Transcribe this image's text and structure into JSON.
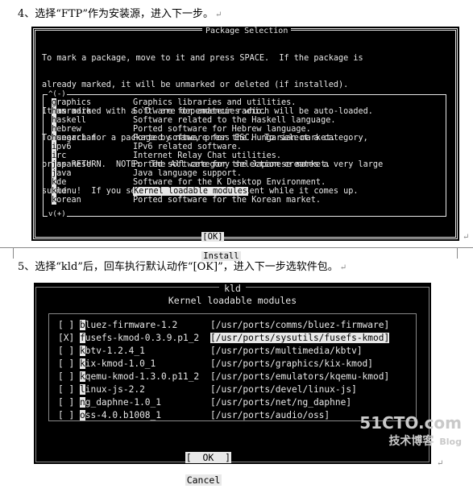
{
  "step4": {
    "caption": "4、选择“FTP”作为安装源，进入下一步。",
    "return_mark": "↵"
  },
  "screen1": {
    "title": "Package Selection",
    "intro_lines": [
      "To mark a package, move to it and press SPACE.  If the package is",
      "already marked, it will be unmarked or deleted (if installed).",
      "Items marked with a `D' are dependencies which will be auto-loaded.",
      "To search for a package by name, press ESC.  To select a category,",
      "press RETURN.  NOTE:  The All category selection creates a very large",
      "submenu!  If you select it, please be patient while it comes up."
    ],
    "scroll_up": "^(-)",
    "scroll_down": "v(+)",
    "categories": [
      {
        "name": "graphics",
        "desc": "Graphics libraries and utilities."
      },
      {
        "name": "hamradio",
        "desc": "Software for amateur radio."
      },
      {
        "name": "haskell",
        "desc": "Software related to the Haskell language."
      },
      {
        "name": "hebrew",
        "desc": "Ported software for Hebrew language."
      },
      {
        "name": "hungarian",
        "desc": "Ported software for the Hungarian market."
      },
      {
        "name": "ipv6",
        "desc": "IPv6 related software."
      },
      {
        "name": "irc",
        "desc": "Internet Relay Chat utilities."
      },
      {
        "name": "japanese",
        "desc": "Ported software for the Japanese market."
      },
      {
        "name": "java",
        "desc": "Java language support."
      },
      {
        "name": "kde",
        "desc": "Software for the K Desktop Environment."
      },
      {
        "name": "kld",
        "desc": "Kernel loadable modules"
      },
      {
        "name": "korean",
        "desc": "Ported software for the Korean market."
      }
    ],
    "selected_index": 10,
    "ok_label": "[OK]",
    "install_label": "Install"
  },
  "step5": {
    "caption": "5、选择“kld”后，回车执行默认动作“[OK]”，进入下一步选软件包。",
    "return_mark": "↵"
  },
  "screen2": {
    "title": "kld",
    "subtitle": "Kernel loadable modules",
    "packages": [
      {
        "mark": "[ ]",
        "name": "bluez-firmware-1.2",
        "path": "[/usr/ports/comms/bluez-firmware]"
      },
      {
        "mark": "[X]",
        "name": "fusefs-kmod-0.3.9.p1_2",
        "path": "[/usr/ports/sysutils/fusefs-kmod]"
      },
      {
        "mark": "[ ]",
        "name": "kbtv-1.2.4_1",
        "path": "[/usr/ports/multimedia/kbtv]"
      },
      {
        "mark": "[ ]",
        "name": "kix-kmod-1.0_1",
        "path": "[/usr/ports/graphics/kix-kmod]"
      },
      {
        "mark": "[ ]",
        "name": "kqemu-kmod-1.3.0.p11_2",
        "path": "[/usr/ports/emulators/kqemu-kmod]"
      },
      {
        "mark": "[ ]",
        "name": "linux-js-2.2",
        "path": "[/usr/ports/devel/linux-js]"
      },
      {
        "mark": "[ ]",
        "name": "ng_daphne-1.0_1",
        "path": "[/usr/ports/net/ng_daphne]"
      },
      {
        "mark": "[ ]",
        "name": "oss-4.0.b1008_1",
        "path": "[/usr/ports/audio/oss]"
      }
    ],
    "selected_index": 1,
    "ok_label": "[  OK  ]",
    "cancel_label": "Cancel"
  },
  "watermark": {
    "line1": "51CTO.com",
    "line2": "技术博客",
    "line3": "Blog"
  }
}
